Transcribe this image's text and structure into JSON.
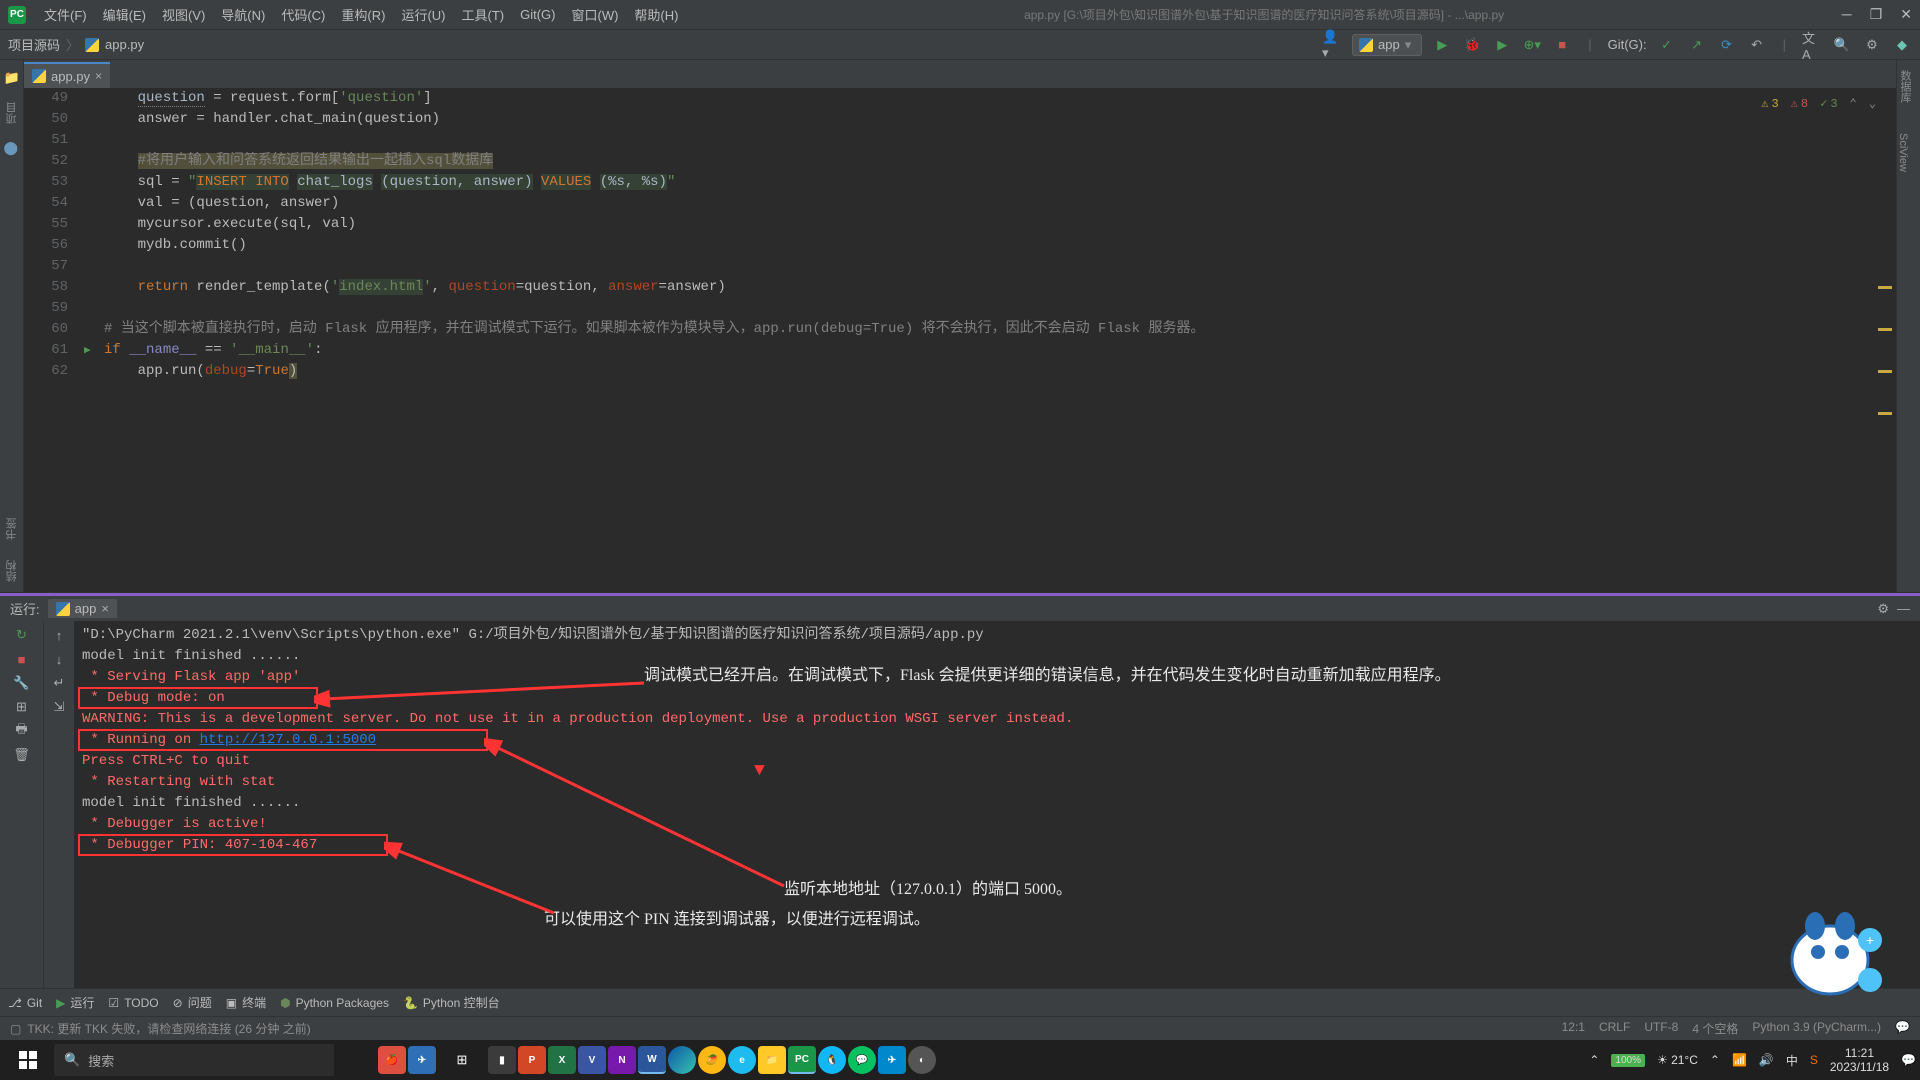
{
  "window": {
    "title_path": "app.py [G:\\项目外包\\知识图谱外包\\基于知识图谱的医疗知识问答系统\\项目源码] - ...\\app.py"
  },
  "menu": {
    "file": "文件(F)",
    "edit": "编辑(E)",
    "view": "视图(V)",
    "nav": "导航(N)",
    "code": "代码(C)",
    "refactor": "重构(R)",
    "run": "运行(U)",
    "tools": "工具(T)",
    "git": "Git(G)",
    "window": "窗口(W)",
    "help": "帮助(H)"
  },
  "breadcrumb": {
    "root": "项目源码",
    "file": "app.py"
  },
  "toolbar": {
    "run_config": "app",
    "git_label": "Git(G):"
  },
  "tab": {
    "name": "app.py"
  },
  "indicators": {
    "warn": "3",
    "err": "8",
    "typo": "3"
  },
  "code_lines": [
    {
      "n": 49,
      "html": "    <span class='c-warn'>question</span> = request.form[<span class='c-str'>'question'</span>]"
    },
    {
      "n": 50,
      "html": "    answer = handler.chat_main(question)"
    },
    {
      "n": 51,
      "html": ""
    },
    {
      "n": 52,
      "html": "    <span class='c-comment c-err'>#将用户输入和问答系统返回结果输出一起插入sql数据库</span>"
    },
    {
      "n": 53,
      "html": "    sql = <span class='c-str'>\"</span><span class='c-sql'>INSERT INTO</span><span class='c-str'> </span><span style='color:#a9b7c6;background:#364135'>chat_logs</span><span class='c-str'> </span><span style='color:#a9b7c6;background:#364135'>(question, answer)</span><span class='c-str'> </span><span class='c-sql'>VALUES</span><span class='c-str'> </span><span style='color:#a9b7c6;background:#364135'>(%s, %s)</span><span class='c-str'>\"</span>"
    },
    {
      "n": 54,
      "html": "    val = (question, answer)"
    },
    {
      "n": 55,
      "html": "    mycursor.execute(sql, val)"
    },
    {
      "n": 56,
      "html": "    mydb.commit()"
    },
    {
      "n": 57,
      "html": ""
    },
    {
      "n": 58,
      "html": "    <span class='c-kw'>return </span>render_template(<span class='c-str'>'</span><span style='color:#6a8759;background:#364135'>index.html</span><span class='c-str'>'</span>, <span style='color:#aa4926'>question</span>=question, <span style='color:#aa4926'>answer</span>=answer)"
    },
    {
      "n": 59,
      "html": ""
    },
    {
      "n": 60,
      "html": "<span class='c-comment'># 当这个脚本被直接执行时，启动 Flask 应用程序，并在调试模式下运行。如果脚本被作为模块导入，app.run(debug=True) 将不会执行，因此不会启动 Flask 服务器。</span>"
    },
    {
      "n": 61,
      "html": "<span class='c-kw'>if </span><span class='c-builtin'>__name__</span> == <span class='c-str'>'__main__'</span>:",
      "play": true
    },
    {
      "n": 62,
      "html": "    app.run(<span style='color:#aa4926'>debug</span>=<span class='c-kw'>True</span><span class='c-err'>)</span>"
    }
  ],
  "run": {
    "tool_label": "运行:",
    "tab_name": "app",
    "lines": [
      {
        "cls": "c-norm",
        "html": "\"D:\\PyCharm 2021.2.1\\venv\\Scripts\\python.exe\" G:/项目外包/知识图谱外包/基于知识图谱的医疗知识问答系统/项目源码/app.py"
      },
      {
        "cls": "c-norm",
        "html": "model init finished ......"
      },
      {
        "cls": "c-red",
        "html": " * Serving Flask app 'app'"
      },
      {
        "cls": "c-red",
        "html": " * Debug mode: on"
      },
      {
        "cls": "c-red",
        "html": "WARNING: This is a development server. Do not use it in a production deployment. Use a production WSGI server instead."
      },
      {
        "cls": "c-red",
        "html": " * Running on <span class='c-link'>http://127.0.0.1:5000</span>"
      },
      {
        "cls": "c-red",
        "html": "Press CTRL+C to quit"
      },
      {
        "cls": "c-red",
        "html": " * Restarting with stat"
      },
      {
        "cls": "c-norm",
        "html": "model init finished ......"
      },
      {
        "cls": "c-red",
        "html": " * Debugger is active!"
      },
      {
        "cls": "c-red",
        "html": " * Debugger PIN: 407-104-467"
      }
    ]
  },
  "annotations": {
    "a1": "调试模式已经开启。在调试模式下，Flask 会提供更详细的错误信息，并在代码发生变化时自动重新加载应用程序。",
    "a2": "监听本地地址（127.0.0.1）的端口 5000。",
    "a3": "可以使用这个 PIN 连接到调试器，以便进行远程调试。"
  },
  "bottom_tabs": {
    "git": "Git",
    "run": "运行",
    "todo": "TODO",
    "problems": "问题",
    "terminal": "终端",
    "packages": "Python Packages",
    "console": "Python 控制台"
  },
  "status": {
    "left": "TKK: 更新 TKK 失败，请检查网络连接 (26 分钟 之前)",
    "pos": "12:1",
    "sep": "CRLF",
    "enc": "UTF-8",
    "indent": "4 个空格",
    "interp": "Python 3.9 (PyCharm...)"
  },
  "taskbar": {
    "search_placeholder": "搜索",
    "weather": "21°C",
    "time": "11:21",
    "date": "2023/11/18"
  },
  "left_strip": {
    "project": "项目",
    "bookmarks": "书签",
    "structure": "结构",
    "sciview": "SciView"
  }
}
